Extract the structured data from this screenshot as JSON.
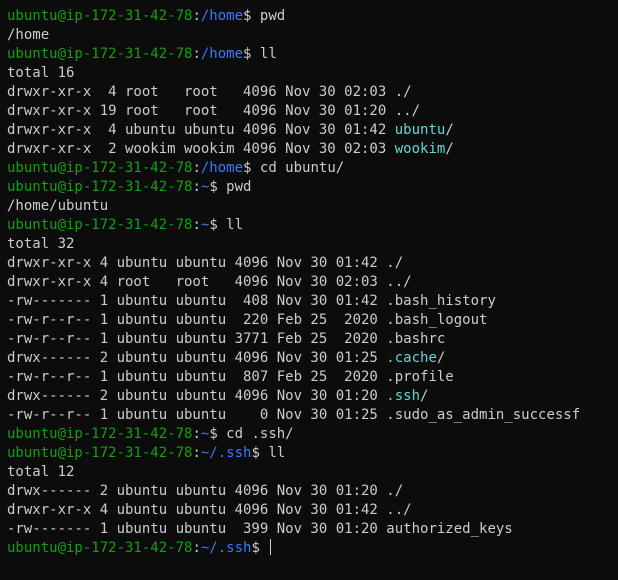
{
  "colors": {
    "background": "#0c0c0c",
    "text": "#cccccc",
    "user_host": "#13a10e",
    "path": "#3b78ff",
    "directory": "#61d6d6"
  },
  "lines": [
    {
      "kind": "prompt",
      "user": "ubuntu@ip-172-31-42-78",
      "path": "/home",
      "cmd": "pwd"
    },
    {
      "kind": "out",
      "text": "/home"
    },
    {
      "kind": "prompt",
      "user": "ubuntu@ip-172-31-42-78",
      "path": "/home",
      "cmd": "ll"
    },
    {
      "kind": "out",
      "text": "total 16"
    },
    {
      "kind": "ls",
      "meta": "drwxr-xr-x  4 root   root   4096 Nov 30 02:03 ",
      "name": "./",
      "dir": false
    },
    {
      "kind": "ls",
      "meta": "drwxr-xr-x 19 root   root   4096 Nov 30 01:20 ",
      "name": "../",
      "dir": false
    },
    {
      "kind": "ls",
      "meta": "drwxr-xr-x  4 ubuntu ubuntu 4096 Nov 30 01:42 ",
      "name": "ubuntu",
      "dir": true,
      "suffix": "/"
    },
    {
      "kind": "ls",
      "meta": "drwxr-xr-x  2 wookim wookim 4096 Nov 30 02:03 ",
      "name": "wookim",
      "dir": true,
      "suffix": "/"
    },
    {
      "kind": "prompt",
      "user": "ubuntu@ip-172-31-42-78",
      "path": "/home",
      "cmd": "cd ubuntu/"
    },
    {
      "kind": "prompt",
      "user": "ubuntu@ip-172-31-42-78",
      "path": "~",
      "cmd": "pwd"
    },
    {
      "kind": "out",
      "text": "/home/ubuntu"
    },
    {
      "kind": "prompt",
      "user": "ubuntu@ip-172-31-42-78",
      "path": "~",
      "cmd": "ll"
    },
    {
      "kind": "out",
      "text": "total 32"
    },
    {
      "kind": "ls",
      "meta": "drwxr-xr-x 4 ubuntu ubuntu 4096 Nov 30 01:42 ",
      "name": "./",
      "dir": false
    },
    {
      "kind": "ls",
      "meta": "drwxr-xr-x 4 root   root   4096 Nov 30 02:03 ",
      "name": "../",
      "dir": false
    },
    {
      "kind": "ls",
      "meta": "-rw------- 1 ubuntu ubuntu  408 Nov 30 01:42 ",
      "name": ".bash_history",
      "dir": false
    },
    {
      "kind": "ls",
      "meta": "-rw-r--r-- 1 ubuntu ubuntu  220 Feb 25  2020 ",
      "name": ".bash_logout",
      "dir": false
    },
    {
      "kind": "ls",
      "meta": "-rw-r--r-- 1 ubuntu ubuntu 3771 Feb 25  2020 ",
      "name": ".bashrc",
      "dir": false
    },
    {
      "kind": "ls",
      "meta": "drwx------ 2 ubuntu ubuntu 4096 Nov 30 01:25 ",
      "name": ".cache",
      "dir": true,
      "suffix": "/"
    },
    {
      "kind": "ls",
      "meta": "-rw-r--r-- 1 ubuntu ubuntu  807 Feb 25  2020 ",
      "name": ".profile",
      "dir": false
    },
    {
      "kind": "ls",
      "meta": "drwx------ 2 ubuntu ubuntu 4096 Nov 30 01:20 ",
      "name": ".ssh",
      "dir": true,
      "suffix": "/"
    },
    {
      "kind": "ls",
      "meta": "-rw-r--r-- 1 ubuntu ubuntu    0 Nov 30 01:25 ",
      "name": ".sudo_as_admin_successf",
      "dir": false
    },
    {
      "kind": "prompt",
      "user": "ubuntu@ip-172-31-42-78",
      "path": "~",
      "cmd": "cd .ssh/"
    },
    {
      "kind": "prompt",
      "user": "ubuntu@ip-172-31-42-78",
      "path": "~/.ssh",
      "cmd": "ll"
    },
    {
      "kind": "out",
      "text": "total 12"
    },
    {
      "kind": "ls",
      "meta": "drwx------ 2 ubuntu ubuntu 4096 Nov 30 01:20 ",
      "name": "./",
      "dir": false
    },
    {
      "kind": "ls",
      "meta": "drwxr-xr-x 4 ubuntu ubuntu 4096 Nov 30 01:42 ",
      "name": "../",
      "dir": false
    },
    {
      "kind": "ls",
      "meta": "-rw------- 1 ubuntu ubuntu  399 Nov 30 01:20 ",
      "name": "authorized_keys",
      "dir": false
    },
    {
      "kind": "prompt",
      "user": "ubuntu@ip-172-31-42-78",
      "path": "~/.ssh",
      "cmd": "",
      "active": true
    }
  ]
}
